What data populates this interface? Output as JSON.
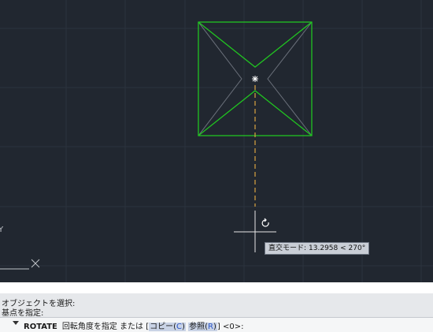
{
  "canvas": {
    "background": "#212730",
    "grid_color": "#2c333e",
    "object_color": "#21c421",
    "preview_color": "#6a707a",
    "tracking_color": "#d9a441"
  },
  "tooltip": {
    "mode_label": "直交モード:",
    "value": "13.2958 < 270°"
  },
  "command_line": {
    "history": [
      "オブジェクトを選択:",
      "基点を指定:"
    ],
    "prompt": {
      "command": "ROTATE",
      "text": "回転角度を指定 または [",
      "options": [
        {
          "label": "コピー(",
          "key": "C",
          "close": ")"
        },
        {
          "label": "参照(",
          "key": "R",
          "close": ")"
        }
      ],
      "tail": "] <0>:"
    }
  },
  "ucs": {
    "label": "Y"
  }
}
